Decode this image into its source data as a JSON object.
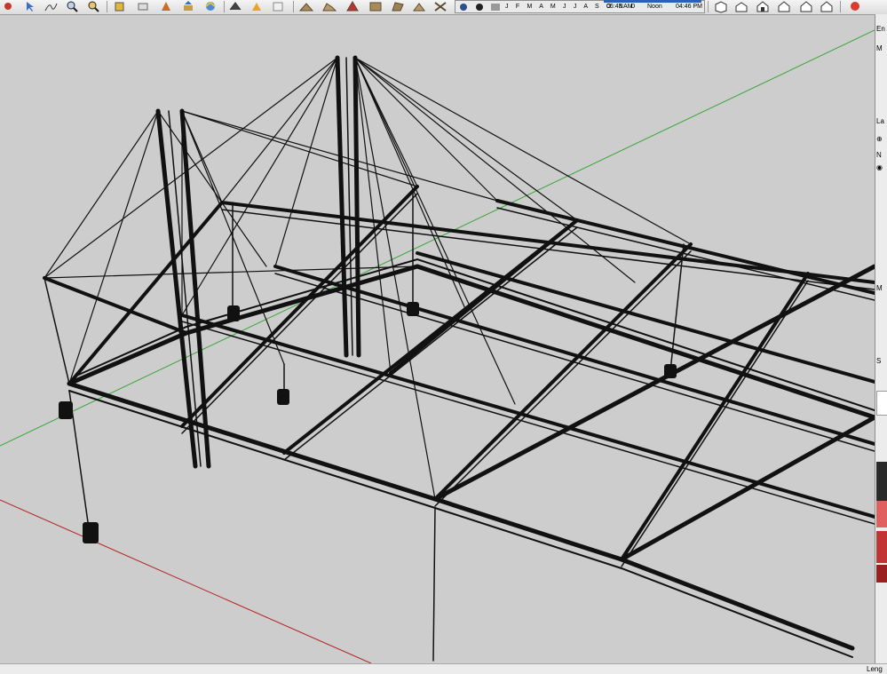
{
  "toolbar": {
    "groups": [
      {
        "name": "standard",
        "icons": [
          "back-icon",
          "select-icon",
          "zoom-icon",
          "zoom-window-icon"
        ]
      },
      {
        "name": "edit",
        "icons": [
          "paint-bucket-icon",
          "eraser-icon",
          "tape-measure-icon",
          "push-pull-icon"
        ]
      },
      {
        "name": "camera",
        "icons": [
          "orbit-icon",
          "walk-icon",
          "position-camera-icon"
        ]
      },
      {
        "name": "sandbox",
        "icons": [
          "terrain-1-icon",
          "terrain-2-icon",
          "terrain-3-icon",
          "terrain-4-icon",
          "terrain-5-icon",
          "terrain-6-icon",
          "terrain-7-icon"
        ]
      },
      {
        "name": "views",
        "icons": [
          "iso-view-icon",
          "top-view-icon",
          "front-view-icon",
          "right-view-icon",
          "back-view-icon",
          "left-view-icon"
        ]
      }
    ]
  },
  "shadows": {
    "months": "J F M A M J J A S O N D",
    "sunrise": "06:43 AM",
    "noon": "Noon",
    "sunset": "04:46 PM"
  },
  "right_panel": {
    "entity_title": "En",
    "entity_field": "M",
    "layers_title": "La",
    "layers_col": "N",
    "materials_title": "M",
    "materials_sel": "S",
    "swatches": [
      "#ffffff",
      "#2a2a2a",
      "#ececec",
      "#e06060",
      "#c23434",
      "#9a1f1f"
    ]
  },
  "status": {
    "measurement_label": "Leng"
  },
  "colors": {
    "sky": "#cdcdcd",
    "green_axis": "#3aa63a",
    "red_axis": "#b32222",
    "structure": "#111111"
  }
}
